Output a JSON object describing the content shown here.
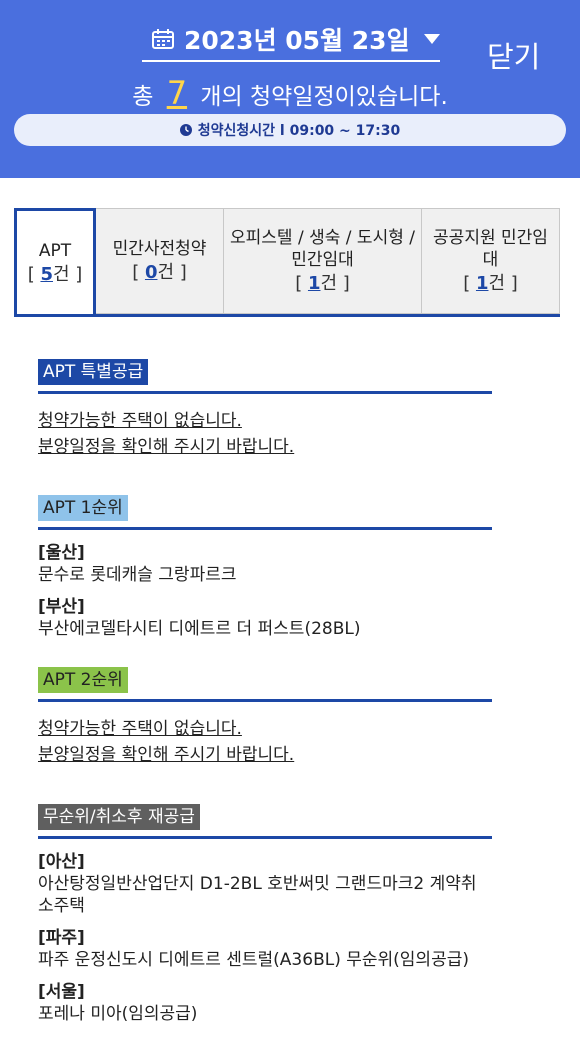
{
  "header": {
    "date": "2023년 05월 23일",
    "close_label": "닫기",
    "count_prefix": "총",
    "count": "7",
    "count_suffix": "개의 청약일정이있습니다.",
    "time_info": "청약신청시간 l 09:00 ~ 17:30",
    "bg_color": "#4a6fde"
  },
  "tabs": [
    {
      "title": "APT",
      "count": "5",
      "open": "[ ",
      "unit": "건 ]"
    },
    {
      "title": "민간사전청약",
      "count": "0",
      "open": "[ ",
      "unit": "건 ]"
    },
    {
      "title": "오피스텔 / 생숙 / 도시형 / 민간임대",
      "count": "1",
      "open": "[ ",
      "unit": "건 ]"
    },
    {
      "title": "공공지원 민간임대",
      "count": "1",
      "open": "[ ",
      "unit": "건 ]"
    }
  ],
  "sections": {
    "special": {
      "label": "APT 특별공급",
      "color": "#1d48a6",
      "empty1": "청약가능한 주택이 없습니다.",
      "empty2": "분양일정을 확인해 주시기 바랍니다."
    },
    "first": {
      "label": "APT 1순위",
      "color": "#8fc3ea",
      "items": [
        {
          "region": "[울산]",
          "name": "문수로 롯데캐슬 그랑파르크"
        },
        {
          "region": "[부산]",
          "name": "부산에코델타시티 디에트르 더 퍼스트(28BL)"
        }
      ]
    },
    "second": {
      "label": "APT 2순위",
      "color": "#8bc34a",
      "empty1": "청약가능한 주택이 없습니다.",
      "empty2": "분양일정을 확인해 주시기 바랍니다."
    },
    "resupply": {
      "label": "무순위/취소후 재공급",
      "color": "#5f5f5f",
      "items": [
        {
          "region": "[아산]",
          "name": "아산탕정일반산업단지 D1-2BL 호반써밋 그랜드마크2 계약취소주택"
        },
        {
          "region": "[파주]",
          "name": "파주 운정신도시 디에트르 센트럴(A36BL) 무순위(임의공급)"
        },
        {
          "region": "[서울]",
          "name": "포레나 미아(임의공급)"
        }
      ]
    }
  }
}
